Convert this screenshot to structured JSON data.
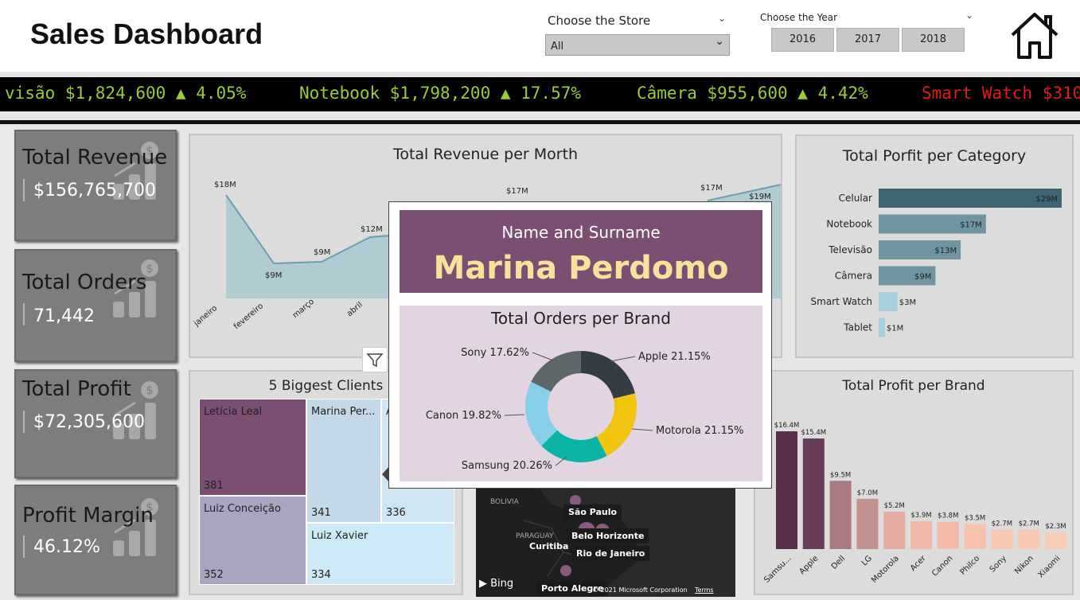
{
  "header": {
    "title": "Sales Dashboard",
    "store_label": "Choose the Store",
    "store_value": "All",
    "year_label": "Choose the Year",
    "years": [
      "2016",
      "2017",
      "2018"
    ]
  },
  "ticker": {
    "items": [
      {
        "text": "visão $1,824,600 ▲ 4.05%",
        "color": "#9acd32"
      },
      {
        "text": "Notebook $1,798,200 ▲ 17.57%",
        "color": "#9acd32"
      },
      {
        "text": "Câmera $955,600 ▲ 4.42%",
        "color": "#9acd32"
      },
      {
        "text": "Smart Watch $310",
        "color": "#e01a1a"
      }
    ]
  },
  "kpis": [
    {
      "title": "Total Revenue",
      "value": "$156,765,700"
    },
    {
      "title": "Total Orders",
      "value": "71,442"
    },
    {
      "title": "Total Profit",
      "value": "$72,305,600"
    },
    {
      "title": "Profit Margin",
      "value": "46.12%"
    }
  ],
  "revenue_chart": {
    "title": "Total Revenue per Morth",
    "months": [
      "janeiro",
      "fevereiro",
      "março",
      "abril"
    ],
    "labels": [
      "$18M",
      "$9M",
      "$9M",
      "$12M",
      "$17M",
      "$17M",
      "$19M"
    ]
  },
  "category_chart": {
    "title": "Total Porfit per Category"
  },
  "clients": {
    "title": "5 Biggest Clients",
    "cells": [
      {
        "name": "Letícia Leal",
        "value": "381"
      },
      {
        "name": "Marina Per...",
        "value": "341"
      },
      {
        "name": "A",
        "value": "336"
      },
      {
        "name": "Luiz Conceição",
        "value": "352"
      },
      {
        "name": "Luiz Xavier",
        "value": "334"
      }
    ]
  },
  "brand_chart": {
    "title": "Total Profit per Brand"
  },
  "popup": {
    "name_label": "Name and Surname",
    "name_value": "Marina Perdomo",
    "brand_title": "Total Orders per Brand",
    "donut_labels": [
      "Apple 21.15%",
      "Motorola 21.15%",
      "Samsung 20.26%",
      "Canon 19.82%",
      "Sony 17.62%"
    ]
  },
  "map": {
    "country": "BOLIVIA",
    "country2": "PARAGUAY",
    "cities": [
      "São Paulo",
      "Belo Horizonte",
      "Rio de Janeiro",
      "Curitiba",
      "Porto Alegre"
    ],
    "bing": "Bing",
    "copyright": "© 2021 Microsoft Corporation",
    "terms": "Terms"
  },
  "chart_data": [
    {
      "type": "area",
      "title": "Total Revenue per Morth",
      "categories": [
        "janeiro",
        "fevereiro",
        "março",
        "abril"
      ],
      "values": [
        18,
        9,
        9,
        12
      ],
      "ylabel": ""
    },
    {
      "type": "bar",
      "title": "Total Porfit per Category",
      "categories": [
        "Celular",
        "Notebook",
        "Televisão",
        "Câmera",
        "Smart Watch",
        "Tablet"
      ],
      "values": [
        29,
        17,
        13,
        9,
        3,
        1
      ],
      "value_labels": [
        "$29M",
        "$17M",
        "$13M",
        "$9M",
        "$3M",
        "$1M"
      ],
      "orientation": "horizontal"
    },
    {
      "type": "bar",
      "title": "Total Profit per Brand",
      "categories": [
        "Samsu...",
        "Apple",
        "Dell",
        "LG",
        "Motorola",
        "Acer",
        "Canon",
        "Philco",
        "Sony",
        "Nikon",
        "Xiaomi"
      ],
      "values": [
        16.4,
        15.4,
        9.5,
        7.0,
        5.2,
        3.9,
        3.8,
        3.5,
        2.7,
        2.7,
        2.3
      ],
      "value_labels": [
        "$16.4M",
        "$15.4M",
        "$9.5M",
        "$7.0M",
        "$5.2M",
        "$3.9M",
        "$3.8M",
        "$3.5M",
        "$2.7M",
        "$2.7M",
        "$2.3M"
      ],
      "colors": [
        "#5a2f4e",
        "#683c5a",
        "#a9797f",
        "#c3918e",
        "#e5aaa0",
        "#f2b8aa",
        "#f5bca9",
        "#f7c2ac",
        "#f8c7b1",
        "#f8c8b3",
        "#f8ccb6"
      ]
    },
    {
      "type": "pie",
      "title": "Total Orders per Brand",
      "categories": [
        "Apple",
        "Motorola",
        "Samsung",
        "Canon",
        "Sony"
      ],
      "values": [
        21.15,
        21.15,
        20.26,
        19.82,
        17.62
      ],
      "colors": [
        "#333d43",
        "#f1c40f",
        "#0bb5a6",
        "#87cfe9",
        "#5d6668"
      ]
    }
  ]
}
